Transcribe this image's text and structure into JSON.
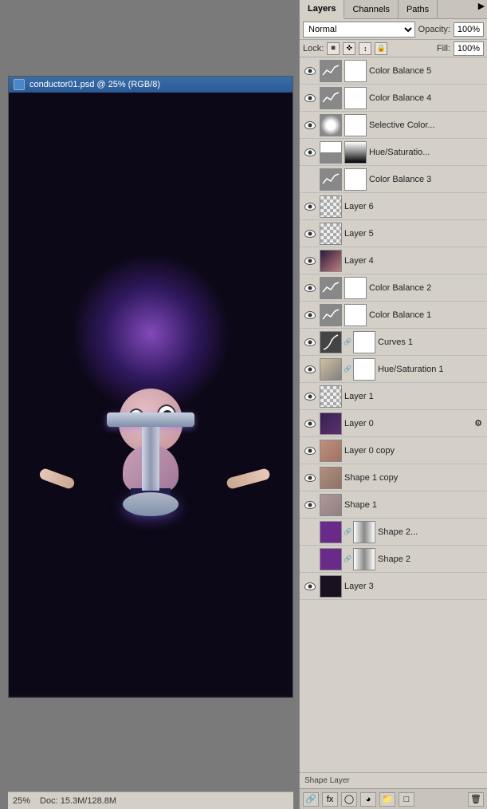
{
  "canvas": {
    "title": "conductor01.psd @ 25% (RGB/8)",
    "zoom": "25%",
    "doc_info": "Doc: 15.3M/128.8M"
  },
  "panel": {
    "tabs": [
      "Layers",
      "Channels",
      "Paths"
    ],
    "active_tab": "Layers",
    "blend_mode": "Normal",
    "opacity_label": "Opacity:",
    "opacity_value": "100%",
    "lock_label": "Lock:",
    "fill_label": "Fill:",
    "fill_value": "100%"
  },
  "layers": [
    {
      "id": 1,
      "name": "Color Balance 5",
      "type": "adjustment-cb",
      "visible": true,
      "selected": false,
      "has_mask": true
    },
    {
      "id": 2,
      "name": "Color Balance 4",
      "type": "adjustment-cb",
      "visible": true,
      "selected": false,
      "has_mask": true
    },
    {
      "id": 3,
      "name": "Selective Color...",
      "type": "adjustment-sel",
      "visible": true,
      "selected": false,
      "has_mask": true
    },
    {
      "id": 4,
      "name": "Hue/Saturatio...",
      "type": "adjustment-hue",
      "visible": true,
      "selected": false,
      "has_mask": true
    },
    {
      "id": 5,
      "name": "Color Balance 3",
      "type": "adjustment-cb",
      "visible": false,
      "selected": false,
      "has_mask": true
    },
    {
      "id": 6,
      "name": "Layer 6",
      "type": "normal",
      "visible": true,
      "selected": false,
      "has_mask": false
    },
    {
      "id": 7,
      "name": "Layer 5",
      "type": "normal",
      "visible": true,
      "selected": false,
      "has_mask": false
    },
    {
      "id": 8,
      "name": "Layer 4",
      "type": "normal-image",
      "visible": true,
      "selected": false,
      "has_mask": false
    },
    {
      "id": 9,
      "name": "Color Balance 2",
      "type": "adjustment-cb",
      "visible": true,
      "selected": false,
      "has_mask": true
    },
    {
      "id": 10,
      "name": "Color Balance 1",
      "type": "adjustment-cb",
      "visible": true,
      "selected": false,
      "has_mask": true
    },
    {
      "id": 11,
      "name": "Curves 1",
      "type": "adjustment-curves",
      "visible": true,
      "selected": false,
      "has_mask": true
    },
    {
      "id": 12,
      "name": "Hue/Saturation 1",
      "type": "adjustment-hue",
      "visible": true,
      "selected": false,
      "has_mask": true
    },
    {
      "id": 13,
      "name": "Layer 1",
      "type": "normal",
      "visible": true,
      "selected": false,
      "has_mask": false
    },
    {
      "id": 14,
      "name": "Layer 0",
      "type": "dark-image",
      "visible": true,
      "selected": false,
      "has_mask": false,
      "has_extra": true
    },
    {
      "id": 15,
      "name": "Layer 0 copy",
      "type": "dark-image",
      "visible": true,
      "selected": false,
      "has_mask": false
    },
    {
      "id": 16,
      "name": "Shape 1 copy",
      "type": "shape",
      "visible": true,
      "selected": false,
      "has_mask": true
    },
    {
      "id": 17,
      "name": "Shape 1",
      "type": "shape",
      "visible": true,
      "selected": false,
      "has_mask": true
    },
    {
      "id": 18,
      "name": "Shape 2...",
      "type": "shape-purple",
      "visible": false,
      "selected": false,
      "has_mask": true
    },
    {
      "id": 19,
      "name": "Shape 2",
      "type": "shape-purple",
      "visible": false,
      "selected": false,
      "has_mask": true
    },
    {
      "id": 20,
      "name": "Layer 3",
      "type": "normal",
      "visible": true,
      "selected": false,
      "has_mask": false
    }
  ],
  "bottom_toolbar": {
    "buttons": [
      "link",
      "fx",
      "mask",
      "group",
      "new",
      "trash"
    ]
  },
  "shape_layer_label": "Shape Layer"
}
